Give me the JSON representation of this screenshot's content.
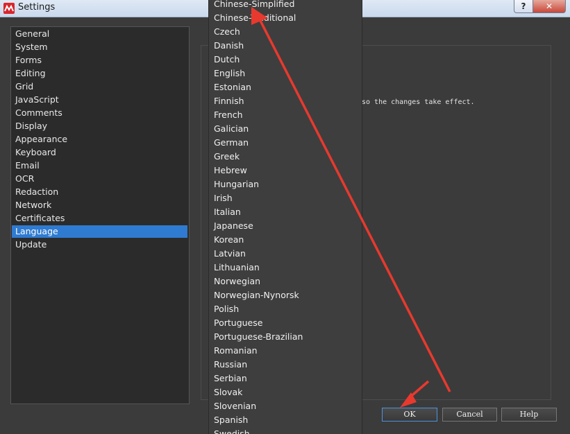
{
  "window": {
    "title": "Settings",
    "help_glyph": "?",
    "close_glyph": "✕"
  },
  "nav": {
    "items": [
      "General",
      "System",
      "Forms",
      "Editing",
      "Grid",
      "JavaScript",
      "Comments",
      "Display",
      "Appearance",
      "Keyboard",
      "Email",
      "OCR",
      "Redaction",
      "Network",
      "Certificates",
      "Language",
      "Update"
    ],
    "selected": "Language"
  },
  "language_panel": {
    "restart_note": "so the changes take effect."
  },
  "buttons": {
    "ok": "OK",
    "cancel": "Cancel",
    "help": "Help"
  },
  "language_dropdown": {
    "options": [
      "Chinese-Simplified",
      "Chinese-Traditional",
      "Czech",
      "Danish",
      "Dutch",
      "English",
      "Estonian",
      "Finnish",
      "French",
      "Galician",
      "German",
      "Greek",
      "Hebrew",
      "Hungarian",
      "Irish",
      "Italian",
      "Japanese",
      "Korean",
      "Latvian",
      "Lithuanian",
      "Norwegian",
      "Norwegian-Nynorsk",
      "Polish",
      "Portuguese",
      "Portuguese-Brazilian",
      "Romanian",
      "Russian",
      "Serbian",
      "Slovak",
      "Slovenian",
      "Spanish",
      "Swedish"
    ]
  },
  "colors": {
    "selection": "#2f7bd1",
    "annotation_arrow": "#e8392e",
    "close_button": "#c8483a"
  }
}
